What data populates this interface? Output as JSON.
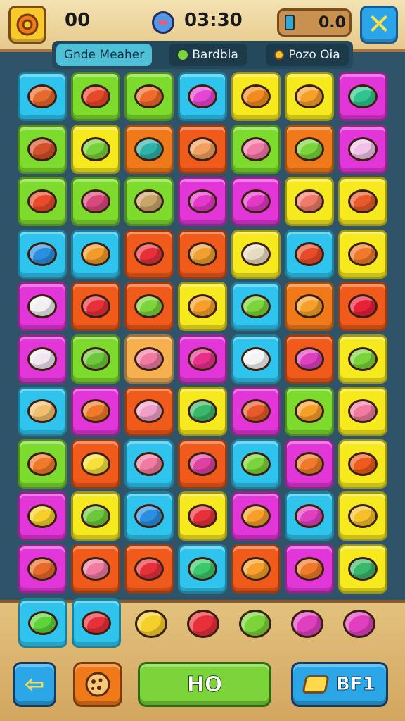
{
  "header": {
    "score": "00",
    "time": "03:30",
    "coins": "0.0"
  },
  "tabs": [
    {
      "label": "Gnde Meaher"
    },
    {
      "label": "Bardbla"
    },
    {
      "label": "Pozo Oia"
    }
  ],
  "board": {
    "rows": [
      [
        {
          "bg": "#2fc4ee",
          "candy": "#e66a2c"
        },
        {
          "bg": "#7ddb2e",
          "candy": "#e8482a"
        },
        {
          "bg": "#7ddb2e",
          "candy": "#ef6a2b"
        },
        {
          "bg": "#2fc4ee",
          "candy": "#e446d4"
        },
        {
          "bg": "#f6ea1e",
          "candy": "#f28b1f"
        },
        {
          "bg": "#f6ea1e",
          "candy": "#f6a02a"
        },
        {
          "bg": "#e236d9",
          "candy": "#2fc48e"
        }
      ],
      [
        {
          "bg": "#7ddb2e",
          "candy": "#d2502a"
        },
        {
          "bg": "#f6ea1e",
          "candy": "#79d13a"
        },
        {
          "bg": "#f07a1a",
          "candy": "#2fb3a8"
        },
        {
          "bg": "#f05a1a",
          "candy": "#f2a060"
        },
        {
          "bg": "#7ddb2e",
          "candy": "#f07aa8"
        },
        {
          "bg": "#f07a1a",
          "candy": "#7bd43a"
        },
        {
          "bg": "#e236d9",
          "candy": "#f0c2e8"
        }
      ],
      [
        {
          "bg": "#7ddb2e",
          "candy": "#e84a2a"
        },
        {
          "bg": "#7ddb2e",
          "candy": "#d8487a"
        },
        {
          "bg": "#7ddb2e",
          "candy": "#c9a56a"
        },
        {
          "bg": "#e236d9",
          "candy": "#e438c8"
        },
        {
          "bg": "#e236d9",
          "candy": "#e438c8"
        },
        {
          "bg": "#f6ea1e",
          "candy": "#f07a6a"
        },
        {
          "bg": "#f6ea1e",
          "candy": "#e85a2a"
        }
      ],
      [
        {
          "bg": "#2fc4ee",
          "candy": "#2a8fe0"
        },
        {
          "bg": "#2fc4ee",
          "candy": "#f29a2a"
        },
        {
          "bg": "#f05a1a",
          "candy": "#e8303a"
        },
        {
          "bg": "#f05a1a",
          "candy": "#f0a030"
        },
        {
          "bg": "#f6ea1e",
          "candy": "#e8dcc0"
        },
        {
          "bg": "#2fc4ee",
          "candy": "#e84a2a"
        },
        {
          "bg": "#f6ea1e",
          "candy": "#f07a2a"
        }
      ],
      [
        {
          "bg": "#e236d9",
          "candy": "#f0f0f0"
        },
        {
          "bg": "#f05a1a",
          "candy": "#e8303a"
        },
        {
          "bg": "#f05a1a",
          "candy": "#7bd43a"
        },
        {
          "bg": "#f6ea1e",
          "candy": "#f6a02a"
        },
        {
          "bg": "#2fc4ee",
          "candy": "#7bd43a"
        },
        {
          "bg": "#f07a1a",
          "candy": "#f6a02a"
        },
        {
          "bg": "#f05a1a",
          "candy": "#e8203a"
        }
      ],
      [
        {
          "bg": "#e236d9",
          "candy": "#f0e6f0"
        },
        {
          "bg": "#7ddb2e",
          "candy": "#6cc83a"
        },
        {
          "bg": "#f6b050",
          "candy": "#f07aa0"
        },
        {
          "bg": "#e236d9",
          "candy": "#e8308a"
        },
        {
          "bg": "#2fc4ee",
          "candy": "#f4f4f4"
        },
        {
          "bg": "#f05a1a",
          "candy": "#e040c0"
        },
        {
          "bg": "#f6ea1e",
          "candy": "#7bd43a"
        }
      ],
      [
        {
          "bg": "#2fc4ee",
          "candy": "#f0c070"
        },
        {
          "bg": "#e236d9",
          "candy": "#f07a2a"
        },
        {
          "bg": "#f05a1a",
          "candy": "#f0a0c8"
        },
        {
          "bg": "#f6ea1e",
          "candy": "#3ab86a"
        },
        {
          "bg": "#e236d9",
          "candy": "#e85a2a"
        },
        {
          "bg": "#7ddb2e",
          "candy": "#f6a02a"
        },
        {
          "bg": "#f6ea1e",
          "candy": "#f07aa0"
        }
      ],
      [
        {
          "bg": "#7ddb2e",
          "candy": "#f07a2a"
        },
        {
          "bg": "#f05a1a",
          "candy": "#f6e03a"
        },
        {
          "bg": "#2fc4ee",
          "candy": "#f07aa0"
        },
        {
          "bg": "#f05a1a",
          "candy": "#e040a0"
        },
        {
          "bg": "#2fc4ee",
          "candy": "#7bd43a"
        },
        {
          "bg": "#e236d9",
          "candy": "#f07a2a"
        },
        {
          "bg": "#f6ea1e",
          "candy": "#f05a1a"
        }
      ],
      [
        {
          "bg": "#e236d9",
          "candy": "#f6d02a"
        },
        {
          "bg": "#f6ea1e",
          "candy": "#6cc83a"
        },
        {
          "bg": "#2fc4ee",
          "candy": "#2a8fe0"
        },
        {
          "bg": "#f6ea1e",
          "candy": "#e8303a"
        },
        {
          "bg": "#e236d9",
          "candy": "#f6a02a"
        },
        {
          "bg": "#2fc4ee",
          "candy": "#e040c0"
        },
        {
          "bg": "#f6ea1e",
          "candy": "#f6c02a"
        }
      ],
      [
        {
          "bg": "#e236d9",
          "candy": "#e86a2a"
        },
        {
          "bg": "#f05a1a",
          "candy": "#f07aa0"
        },
        {
          "bg": "#f05a1a",
          "candy": "#e8303a"
        },
        {
          "bg": "#2fc4ee",
          "candy": "#3ac86a"
        },
        {
          "bg": "#f05a1a",
          "candy": "#f6a02a"
        },
        {
          "bg": "#e236d9",
          "candy": "#f07a2a"
        },
        {
          "bg": "#f6ea1e",
          "candy": "#3ab86a"
        }
      ]
    ]
  },
  "tray": [
    {
      "bg": "#2fc4ee",
      "candy": "#5cd43a"
    },
    {
      "bg": "#2fc4ee",
      "candy": "#e8303a"
    }
  ],
  "loose_candies": [
    "#f6d02a",
    "#e8303a",
    "#7bd43a",
    "#e040c0",
    "#e040c0"
  ],
  "controls": {
    "play_label": "HO",
    "shop_label": "BF1"
  }
}
